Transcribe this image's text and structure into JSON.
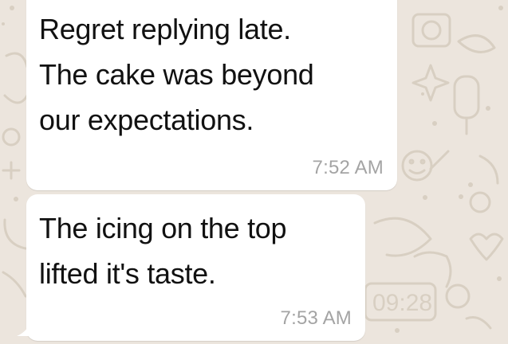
{
  "chat": {
    "messages": [
      {
        "text": "Regret replying late.\nThe cake was beyond\nour expectations.",
        "time": "7:52 AM",
        "direction": "incoming"
      },
      {
        "text": "The icing on the top\nlifted it's taste.",
        "time": "7:53 AM",
        "direction": "incoming"
      }
    ],
    "wallpaper": {
      "background_color": "#ece5dd",
      "doodle_color": "#d8cfc2",
      "doodle_clock_text": "09:28"
    },
    "bubble_color": "#ffffff"
  }
}
